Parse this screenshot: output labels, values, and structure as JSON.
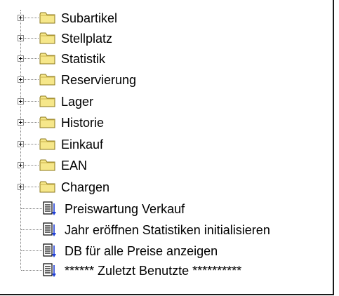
{
  "tree": {
    "folders": [
      {
        "label": "Subartikel",
        "icon": "folder-icon",
        "expandable": true
      },
      {
        "label": "Stellplatz",
        "icon": "folder-icon",
        "expandable": true
      },
      {
        "label": "Statistik",
        "icon": "folder-icon",
        "expandable": true
      },
      {
        "label": "Reservierung",
        "icon": "folder-icon",
        "expandable": true
      },
      {
        "label": "Lager",
        "icon": "folder-icon",
        "expandable": true
      },
      {
        "label": "Historie",
        "icon": "folder-icon",
        "expandable": true
      },
      {
        "label": "Einkauf",
        "icon": "folder-icon",
        "expandable": true
      },
      {
        "label": "EAN",
        "icon": "folder-icon",
        "expandable": true
      },
      {
        "label": "Chargen",
        "icon": "folder-icon",
        "expandable": true
      }
    ],
    "items": [
      {
        "label": "Preiswartung Verkauf",
        "icon": "document-list-icon"
      },
      {
        "label": "Jahr eröffnen Statistiken initialisieren",
        "icon": "document-list-icon"
      },
      {
        "label": "DB für alle Preise anzeigen",
        "icon": "document-list-icon"
      },
      {
        "label": "****** Zuletzt Benutzte **********",
        "icon": "document-list-icon"
      }
    ]
  },
  "colors": {
    "folder_fill": "#f6e78a",
    "folder_outline": "#8c7a1e",
    "doc_arrow": "#1f3fd6",
    "tree_lines": "#808080",
    "panel_border": "#1a1a1a"
  }
}
